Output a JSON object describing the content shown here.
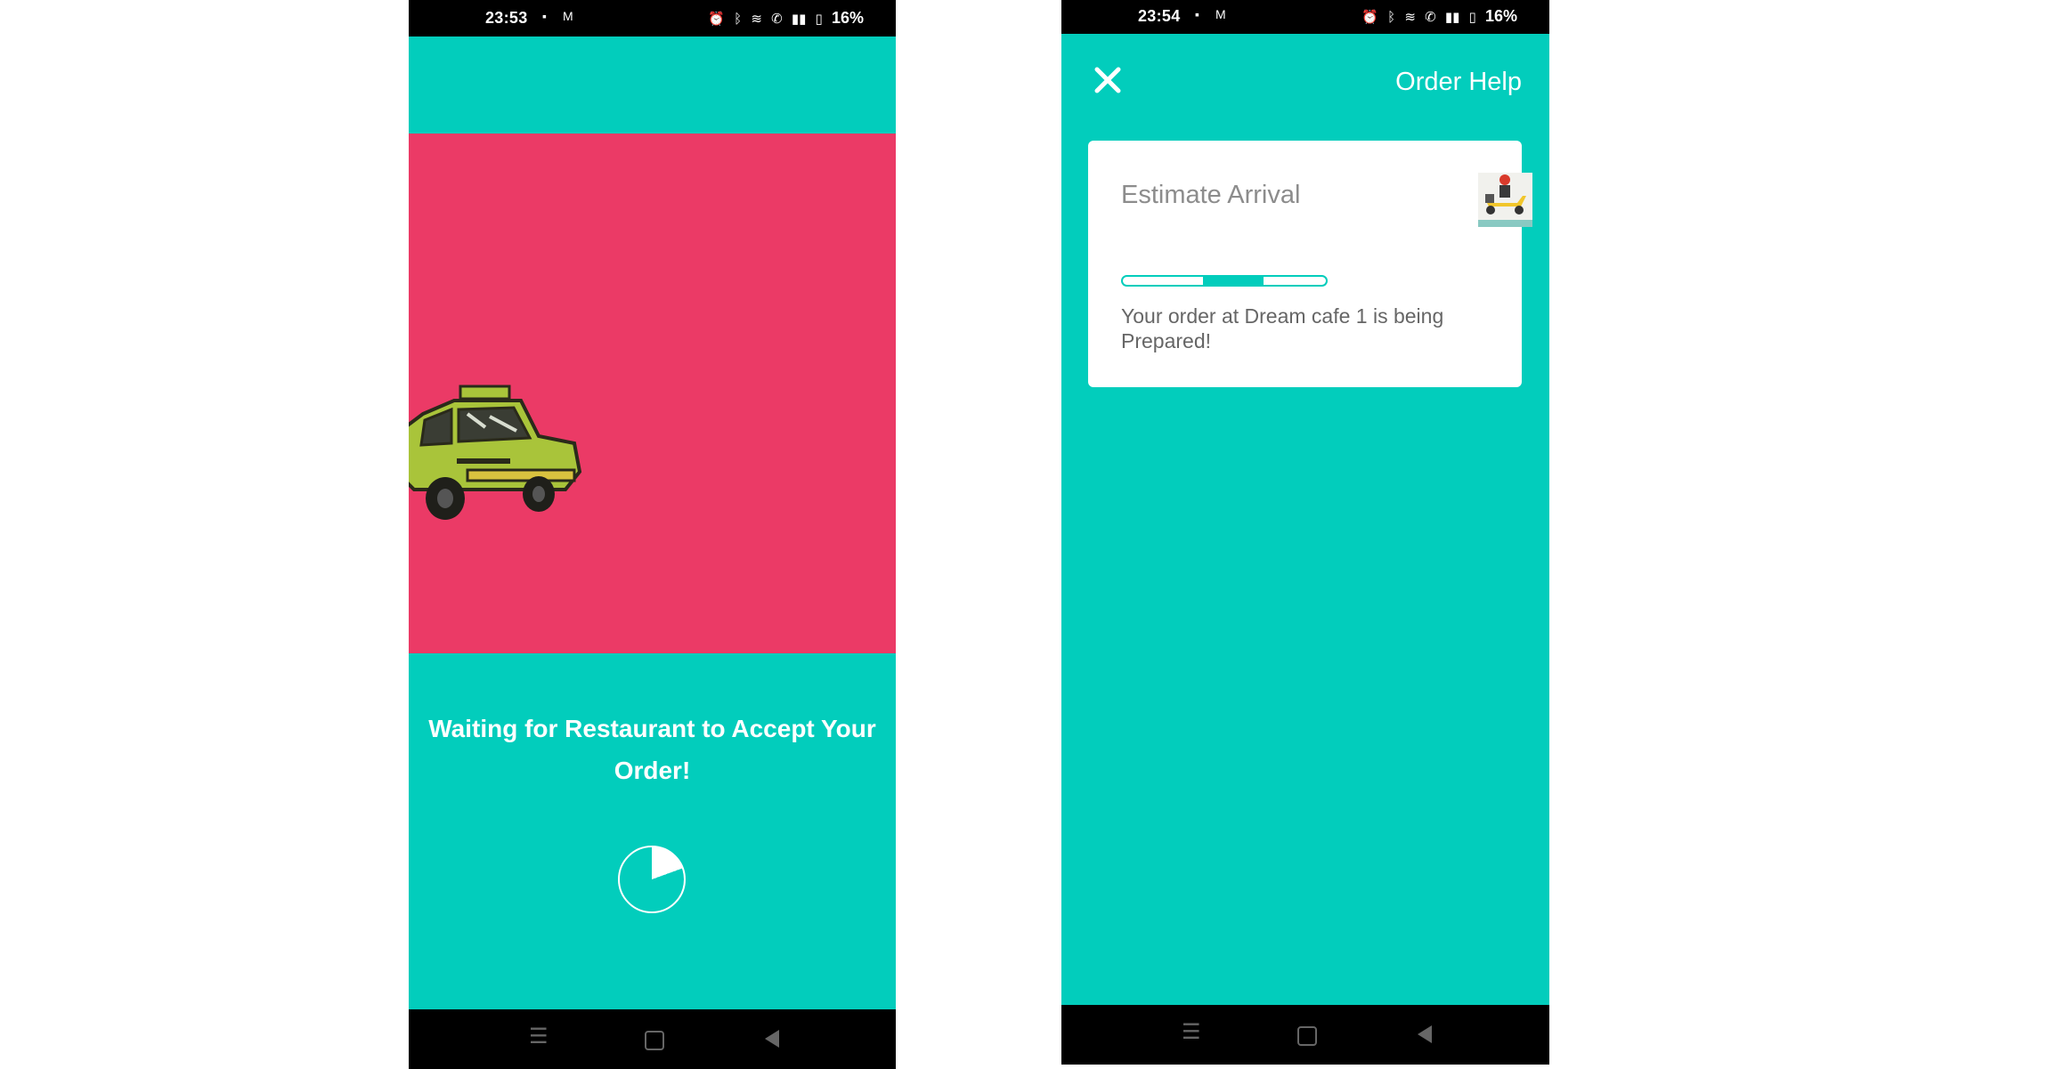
{
  "phone1": {
    "status": {
      "time": "23:53",
      "battery": "16%"
    },
    "waiting_message": "Waiting for Restaurant to Accept Your Order!",
    "loader_progress": 0.19
  },
  "phone2": {
    "status": {
      "time": "23:54",
      "battery": "16%"
    },
    "header": {
      "order_help_label": "Order Help"
    },
    "card": {
      "title": "Estimate Arrival",
      "status_message": "Your order at Dream cafe 1 is being Prepared!"
    }
  },
  "colors": {
    "teal": "#02cdbc",
    "pink": "#eb3a66",
    "taxi": "#a9c43a"
  },
  "icons": [
    "alarm-icon",
    "bluetooth-icon",
    "wifi-icon",
    "call-icon",
    "signal-icon",
    "battery-icon",
    "close-icon",
    "scooter-icon",
    "taxi-icon"
  ]
}
